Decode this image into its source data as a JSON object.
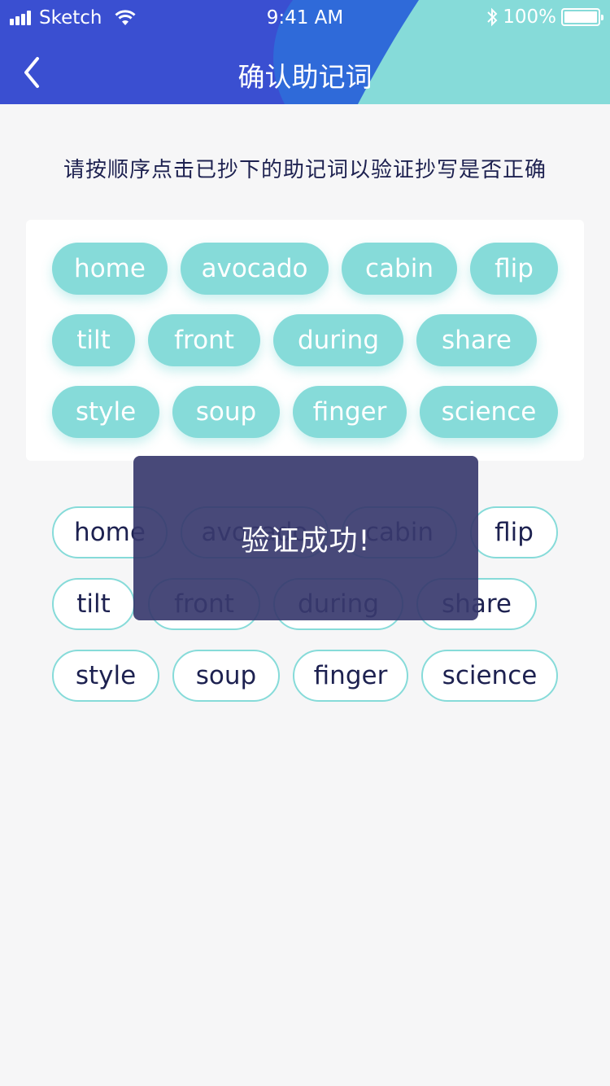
{
  "status_bar": {
    "carrier": "Sketch",
    "time": "9:41 AM",
    "battery": "100%"
  },
  "nav": {
    "title": "确认助记词",
    "back_icon": "chevron-left-icon"
  },
  "instruction": "请按顺序点击已抄下的助记词以验证抄写是否正确",
  "selected_words": [
    "home",
    "avocado",
    "cabin",
    "flip",
    "tilt",
    "front",
    "during",
    "share",
    "style",
    "soup",
    "finger",
    "science"
  ],
  "word_options": [
    "home",
    "avocado",
    "cabin",
    "flip",
    "tilt",
    "front",
    "during",
    "share",
    "style",
    "soup",
    "finger",
    "science"
  ],
  "toast": "验证成功!",
  "colors": {
    "header_blue": "#3a4fd1",
    "header_teal": "#86dbd9",
    "chip_teal": "#86dbd9",
    "text_dark": "#1d2150",
    "toast_bg": "#383a6e"
  }
}
